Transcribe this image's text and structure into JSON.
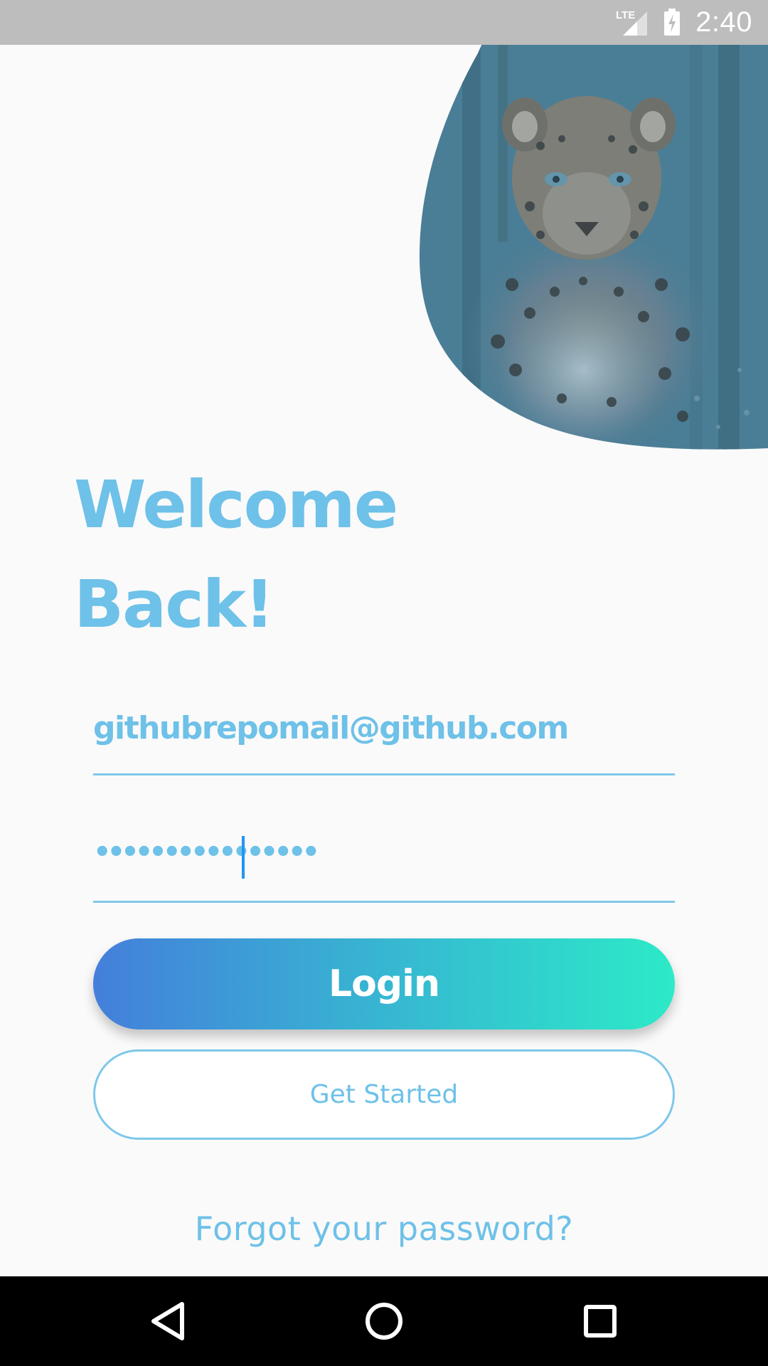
{
  "status_bar": {
    "time": "2:40",
    "network_label": "LTE",
    "icons": [
      "lte-signal-icon",
      "battery-charging-icon"
    ]
  },
  "hero": {
    "image_icon": "leopard-photo",
    "tint_color": "#4a7f97"
  },
  "title": {
    "line1": "Welcome",
    "line2": "Back!"
  },
  "login_form": {
    "email_value": "githubrepomail@github.com",
    "password_value": "••••••••••••••••"
  },
  "buttons": {
    "login_label": "Login",
    "get_started_label": "Get Started",
    "forgot_password_label": "Forgot your password?"
  },
  "nav_bar": {
    "icons": [
      "back-icon",
      "home-icon",
      "recents-icon"
    ]
  },
  "colors": {
    "accent": "#6ec1e8",
    "gradient_start": "#447fdb",
    "gradient_end": "#2ceac7",
    "status_bar": "#bdbdbd",
    "nav_bar": "#000000"
  }
}
